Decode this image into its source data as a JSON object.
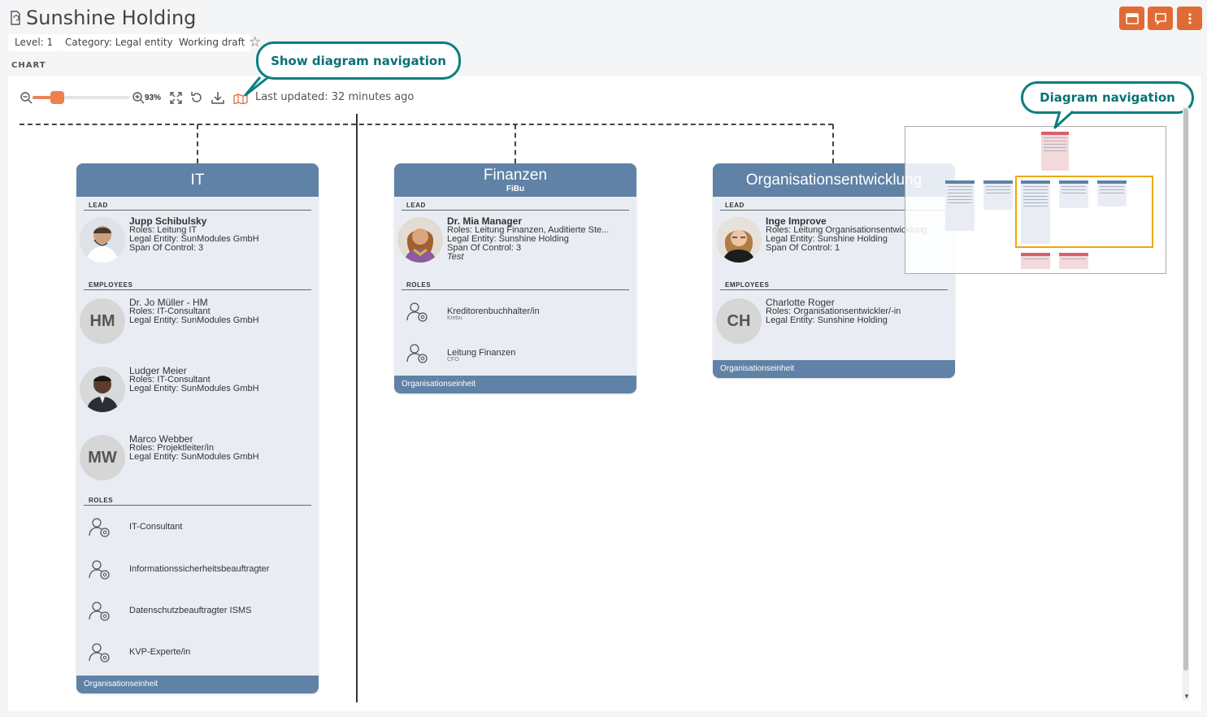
{
  "header": {
    "title": "Sunshine Holding",
    "chips": [
      "Level: 1",
      "Category: Legal entity",
      "Working draft"
    ],
    "section_label": "CHART",
    "buttons": [
      "panel",
      "comment",
      "more"
    ]
  },
  "toolbar": {
    "zoom_value": "93%",
    "zoom_level": 0.25,
    "last_updated": "Last updated: 32 minutes ago"
  },
  "callouts": {
    "show_nav": "Show diagram navigation",
    "diagram_nav": "Diagram navigation"
  },
  "cards": {
    "it": {
      "title": "IT",
      "lead_label": "LEAD",
      "lead": {
        "name": "Jupp Schibulsky",
        "roles": "Roles: Leitung IT",
        "legal": "Legal Entity: SunModules GmbH",
        "span": "Span Of Control: 3"
      },
      "employees_label": "EMPLOYEES",
      "employees": [
        {
          "initials": "HM",
          "name": "Dr. Jo Müller - HM",
          "roles": "Roles: IT-Consultant",
          "legal": "Legal Entity: SunModules GmbH"
        },
        {
          "initials": "",
          "name": "Ludger Meier",
          "roles": "Roles: IT-Consultant",
          "legal": "Legal Entity: SunModules GmbH"
        },
        {
          "initials": "MW",
          "name": "Marco Webber",
          "roles": "Roles: Projektleiter/in",
          "legal": "Legal Entity: SunModules GmbH"
        }
      ],
      "roles_label": "ROLES",
      "roles": [
        "IT-Consultant",
        "Informationssicherheitsbeauftragter",
        "Datenschutzbeauftragter ISMS",
        "KVP-Experte/in"
      ],
      "footer": "Organisationseinheit"
    },
    "finanzen": {
      "title": "Finanzen",
      "subtitle": "FiBu",
      "lead_label": "LEAD",
      "lead": {
        "name": "Dr. Mia Manager",
        "roles": "Roles: Leitung Finanzen, Auditierte Ste...",
        "legal": "Legal Entity: Sunshine Holding",
        "span": "Span Of Control: 3",
        "note": "Test"
      },
      "roles_label": "ROLES",
      "roles": [
        {
          "label": "Kreditorenbuchhalter/in",
          "sub": "Krebu"
        },
        {
          "label": "Leitung Finanzen",
          "sub": "CFO"
        }
      ],
      "footer": "Organisationseinheit"
    },
    "orga": {
      "title": "Organisationsentwicklung",
      "lead_label": "LEAD",
      "lead": {
        "name": "Inge Improve",
        "roles": "Roles: Leitung Organisationsentwicklung",
        "legal": "Legal Entity: Sunshine Holding",
        "span": "Span Of Control: 1"
      },
      "employees_label": "EMPLOYEES",
      "employees": [
        {
          "initials": "CH",
          "name": "Charlotte Roger",
          "roles": "Roles: Organisationsentwickler/-in",
          "legal": "Legal Entity: Sunshine Holding"
        }
      ],
      "footer": "Organisationseinheit"
    }
  },
  "colors": {
    "accent": "#e06b35",
    "card_header": "#5f82a6",
    "callout": "#0b7f7f",
    "viewport": "#f0a800"
  }
}
